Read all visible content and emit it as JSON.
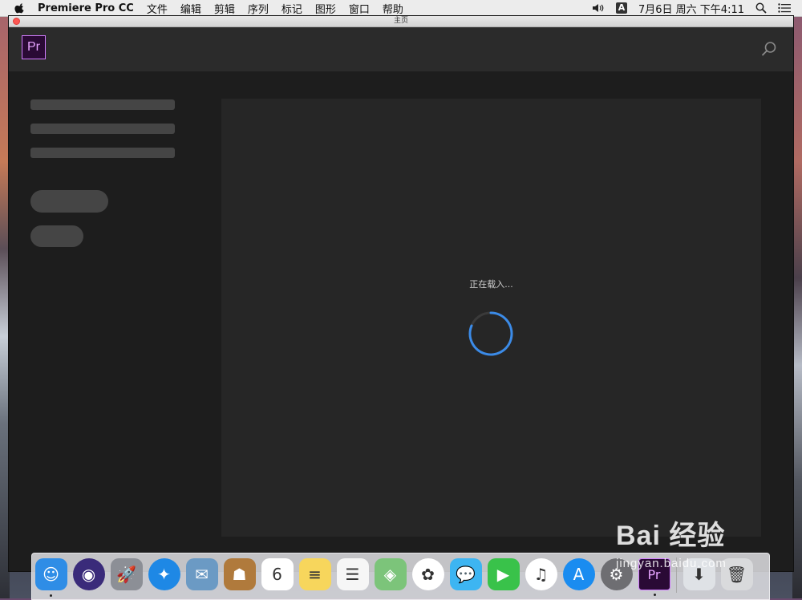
{
  "menubar": {
    "app_name": "Premiere Pro CC",
    "menus": [
      "文件",
      "编辑",
      "剪辑",
      "序列",
      "标记",
      "图形",
      "窗口",
      "帮助"
    ],
    "ime_label": "A",
    "datetime": "7月6日 周六 下午4:11"
  },
  "window": {
    "title": "主页",
    "logo_text": "Pr",
    "loading_text": "正在载入..."
  },
  "colors": {
    "accent_purple": "#d17cff",
    "spinner_blue": "#3b8be8",
    "background": "#1d1d1d"
  },
  "dock": {
    "items": [
      {
        "name": "finder-icon",
        "glyph": "☺",
        "bg": "#2f8de6",
        "running": true
      },
      {
        "name": "siri-icon",
        "glyph": "◉",
        "bg": "#3a2b7a",
        "running": false
      },
      {
        "name": "launchpad-icon",
        "glyph": "🚀",
        "bg": "#8c8f96",
        "running": false
      },
      {
        "name": "safari-icon",
        "glyph": "✦",
        "bg": "#1e88e5",
        "running": false
      },
      {
        "name": "preview-icon",
        "glyph": "✉",
        "bg": "#6b9ac4",
        "running": false
      },
      {
        "name": "contacts-icon",
        "glyph": "☗",
        "bg": "#b07a3c",
        "running": false
      },
      {
        "name": "calendar-icon",
        "glyph": "6",
        "bg": "#ffffff",
        "running": false
      },
      {
        "name": "notes-icon",
        "glyph": "≡",
        "bg": "#f7d65c",
        "running": false
      },
      {
        "name": "reminders-icon",
        "glyph": "☰",
        "bg": "#f6f6f6",
        "running": false
      },
      {
        "name": "maps-icon",
        "glyph": "◈",
        "bg": "#7cc47a",
        "running": false
      },
      {
        "name": "photos-icon",
        "glyph": "✿",
        "bg": "#ffffff",
        "running": false
      },
      {
        "name": "messages-icon",
        "glyph": "💬",
        "bg": "#3db5f2",
        "running": false
      },
      {
        "name": "facetime-icon",
        "glyph": "▶",
        "bg": "#39c24a",
        "running": false
      },
      {
        "name": "itunes-icon",
        "glyph": "♫",
        "bg": "#ffffff",
        "running": false
      },
      {
        "name": "app-store-icon",
        "glyph": "A",
        "bg": "#1a8cf0",
        "running": false
      },
      {
        "name": "system-preferences-icon",
        "glyph": "⚙",
        "bg": "#6e6e72",
        "running": false
      },
      {
        "name": "premiere-pro-icon",
        "glyph": "Pr",
        "bg": "#2a0a35",
        "running": true
      }
    ],
    "extras": [
      {
        "name": "downloads-stack-icon",
        "glyph": "⬇",
        "bg": "#dfe2e6"
      },
      {
        "name": "trash-icon",
        "glyph": "🗑",
        "bg": "#d9dadc"
      }
    ]
  },
  "watermark": {
    "big": "Bai 经验",
    "small": "jingyan.baidu.com"
  }
}
